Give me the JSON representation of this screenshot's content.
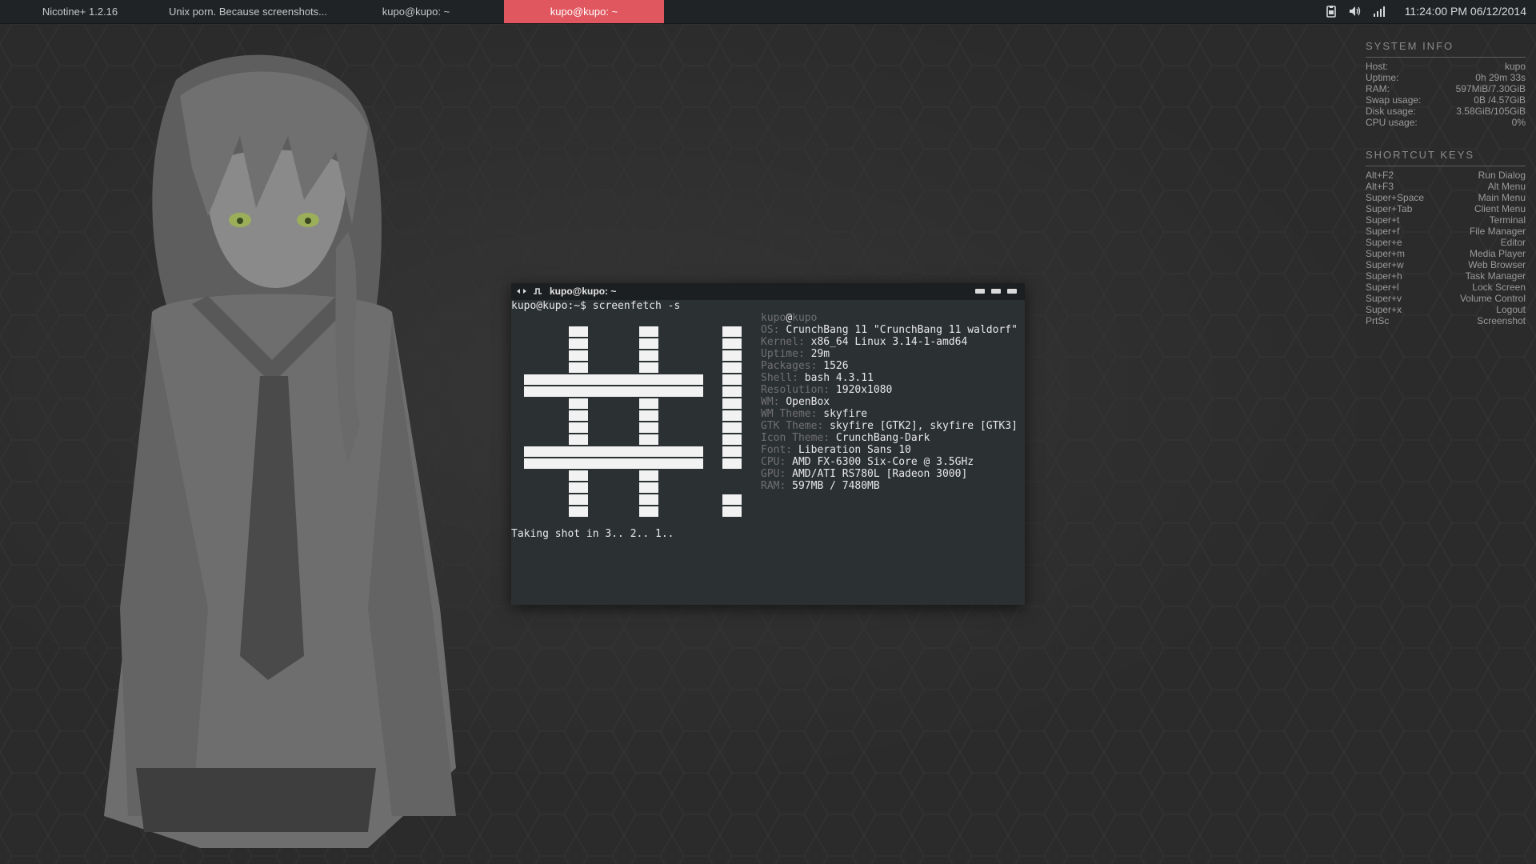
{
  "panel": {
    "tasks": [
      "Nicotine+ 1.2.16",
      "Unix porn. Because screenshots...",
      "kupo@kupo: ~",
      "kupo@kupo: ~"
    ],
    "active_task_index": 3,
    "tray_icons": [
      "clipboard-icon",
      "volume-icon",
      "signal-icon"
    ],
    "clock": "11:24:00 PM 06/12/2014"
  },
  "conky": {
    "system_info": {
      "title": "SYSTEM INFO",
      "rows": [
        {
          "label": "Host:",
          "value": "kupo"
        },
        {
          "label": "Uptime:",
          "value": "0h 29m 33s"
        },
        {
          "label": "RAM:",
          "value": "597MiB/7.30GiB"
        },
        {
          "label": "Swap usage:",
          "value": "0B  /4.57GiB"
        },
        {
          "label": "Disk usage:",
          "value": "3.58GiB/105GiB"
        },
        {
          "label": "CPU usage:",
          "value": "0%"
        }
      ]
    },
    "shortcut_keys": {
      "title": "SHORTCUT KEYS",
      "rows": [
        {
          "label": "Alt+F2",
          "value": "Run Dialog"
        },
        {
          "label": "Alt+F3",
          "value": "Alt Menu"
        },
        {
          "label": "Super+Space",
          "value": "Main Menu"
        },
        {
          "label": "Super+Tab",
          "value": "Client Menu"
        },
        {
          "label": "Super+t",
          "value": "Terminal"
        },
        {
          "label": "Super+f",
          "value": "File Manager"
        },
        {
          "label": "Super+e",
          "value": "Editor"
        },
        {
          "label": "Super+m",
          "value": "Media Player"
        },
        {
          "label": "Super+w",
          "value": "Web Browser"
        },
        {
          "label": "Super+h",
          "value": "Task Manager"
        },
        {
          "label": "Super+l",
          "value": "Lock Screen"
        },
        {
          "label": "Super+v",
          "value": "Volume Control"
        },
        {
          "label": "Super+x",
          "value": "Logout"
        },
        {
          "label": "PrtSc",
          "value": "Screenshot"
        }
      ]
    }
  },
  "terminal": {
    "title": "kupo@kupo: ~",
    "prompt_line": "kupo@kupo:~$ screenfetch -s",
    "footer_line": "Taking shot in 3.. 2.. 1..",
    "user_host": {
      "user": "kupo",
      "at": "@",
      "host": "kupo"
    },
    "info": [
      {
        "key": "OS:",
        "value": "CrunchBang 11 \"CrunchBang 11 waldorf\""
      },
      {
        "key": "Kernel:",
        "value": "x86_64 Linux 3.14-1-amd64"
      },
      {
        "key": "Uptime:",
        "value": "29m"
      },
      {
        "key": "Packages:",
        "value": "1526"
      },
      {
        "key": "Shell:",
        "value": "bash 4.3.11"
      },
      {
        "key": "Resolution:",
        "value": "1920x1080"
      },
      {
        "key": "WM:",
        "value": "OpenBox"
      },
      {
        "key": "WM Theme:",
        "value": "skyfire"
      },
      {
        "key": "GTK Theme:",
        "value": "skyfire [GTK2], skyfire [GTK3]"
      },
      {
        "key": "Icon Theme:",
        "value": "CrunchBang-Dark"
      },
      {
        "key": "Font:",
        "value": "Liberation Sans 10"
      },
      {
        "key": "CPU:",
        "value": "AMD FX-6300 Six-Core @ 3.5GHz"
      },
      {
        "key": "GPU:",
        "value": "AMD/ATI RS780L [Radeon 3000]"
      },
      {
        "key": "RAM:",
        "value": "597MB / 7480MB"
      }
    ]
  },
  "colors": {
    "active_task": "#e0575f",
    "panel_bg": "#1f2326",
    "terminal_bg": "#2b3033",
    "label_gray": "#707070"
  }
}
